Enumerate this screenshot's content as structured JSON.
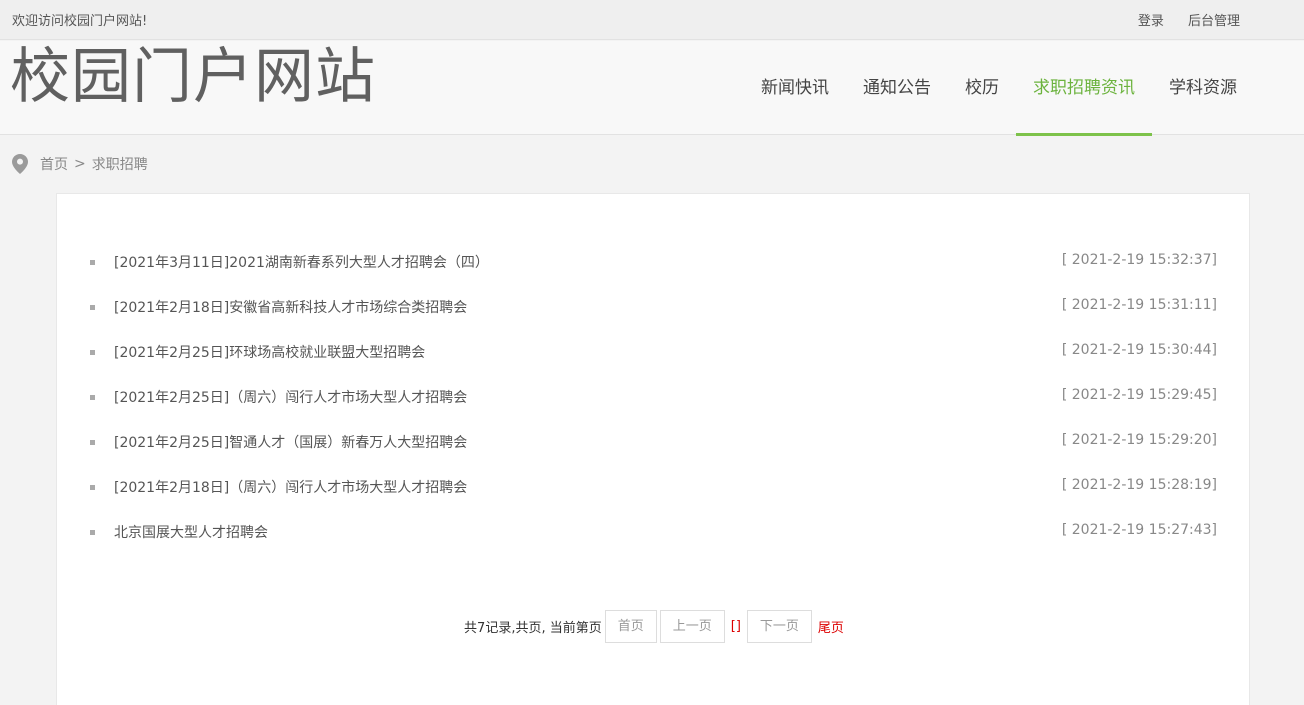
{
  "topbar": {
    "welcome": "欢迎访问校园门户网站!",
    "login": "登录",
    "admin": "后台管理"
  },
  "header": {
    "site_title": "校园门户网站",
    "nav": [
      {
        "label": "新闻快讯"
      },
      {
        "label": "通知公告"
      },
      {
        "label": "校历"
      },
      {
        "label": "求职招聘资讯",
        "active": true
      },
      {
        "label": "学科资源"
      }
    ]
  },
  "breadcrumb": {
    "home": "首页",
    "separator": ">",
    "current": "求职招聘"
  },
  "list": [
    {
      "title": "[2021年3月11日]2021湖南新春系列大型人才招聘会（四）",
      "date": "[ 2021-2-19 15:32:37]"
    },
    {
      "title": "[2021年2月18日]安徽省高新科技人才市场综合类招聘会",
      "date": "[ 2021-2-19 15:31:11]"
    },
    {
      "title": "[2021年2月25日]环球场高校就业联盟大型招聘会",
      "date": "[ 2021-2-19 15:30:44]"
    },
    {
      "title": "[2021年2月25日]（周六）闯行人才市场大型人才招聘会",
      "date": "[ 2021-2-19 15:29:45]"
    },
    {
      "title": "[2021年2月25日]智通人才（国展）新春万人大型招聘会",
      "date": "[ 2021-2-19 15:29:20]"
    },
    {
      "title": "[2021年2月18日]（周六）闯行人才市场大型人才招聘会",
      "date": "[ 2021-2-19 15:28:19]"
    },
    {
      "title": "北京国展大型人才招聘会",
      "date": "[ 2021-2-19 15:27:43]"
    }
  ],
  "pager": {
    "summary": "共7记录,共页, 当前第页",
    "first": "首页",
    "prev": "上一页",
    "current_marker": "[]",
    "next": "下一页",
    "last": "尾页"
  },
  "colors": {
    "accent": "#6cb33e",
    "pager_red": "#dd0000"
  }
}
